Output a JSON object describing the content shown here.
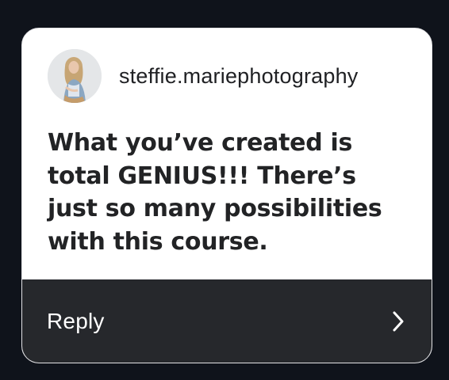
{
  "comment": {
    "username": "steffie.mariephotography",
    "text": "What you’ve created is total GENIUS!!! There’s just so many possibilities with this course.",
    "reply_label": "Reply",
    "reply_icon": "chevron-right-icon"
  },
  "colors": {
    "page_background": "#0f131b",
    "card_background": "#ffffff",
    "reply_bar_background": "#26282c",
    "reply_text": "#ffffff",
    "message_text": "#222325"
  }
}
